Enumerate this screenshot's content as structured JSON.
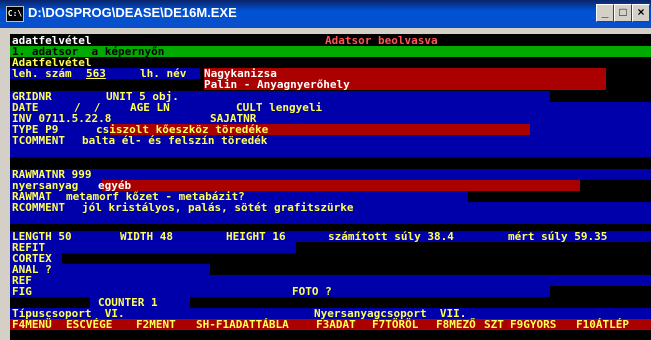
{
  "window": {
    "title": "D:\\DOSPROG\\DEASE\\DE16M.EXE",
    "icon_label": "C:\\",
    "minimize": "_",
    "maximize": "□",
    "close": "×"
  },
  "screen": {
    "header_left": "adatfelvétel",
    "header_right": "Adatsor beolvasva",
    "menu_line": "1. adatsor  a képernyőn",
    "section_title": "Adatfelvétel",
    "leh_label": "leh. szám",
    "leh_value": "563",
    "lh_label": "lh. név",
    "lh_value1": "Nagykanizsa",
    "lh_value2": "Palin - Anyagnyerőhely",
    "gridnr_label": "GRIDNR",
    "unit_label": "UNIT 5 obj.",
    "date_label": "DATE",
    "date_value": "/  /",
    "age_label": "AGE LN",
    "cult_label": "CULT lengyeli",
    "inv_label": "INV 0711.5.22.8",
    "sajatnr_label": "SAJATNR",
    "type_label": "TYPE P9",
    "type_value": "csiszolt kőeszköz töredéke",
    "tcomment_label": "TCOMMENT",
    "tcomment_value": "balta él- és felszín töredék",
    "rawmatnr_label": "RAWMATNR 999",
    "nyersanyag_label": "nyersanyag",
    "nyersanyag_value": "egyéb",
    "rawmat_label": "RAWMAT",
    "rawmat_value": "metamorf kőzet - metabázit?",
    "rcomment_label": "RCOMMENT",
    "rcomment_value": "jól kristályos, palás, sötét grafitszürke",
    "length": "LENGTH 50",
    "width": "WIDTH 48",
    "height": "HEIGHT 16",
    "computed_weight": "számított súly 38.4",
    "measured_weight": "mért súly 59.35",
    "refit": "REFIT",
    "cortex": "CORTEX",
    "anal": "ANAL ?",
    "ref": "REF",
    "fig": "FIG",
    "foto": "FOTO ?",
    "counter": "COUNTER 1",
    "tipuscsoport": "Típuscsoport  VI.",
    "nyersanyagcsoport": "Nyersanyagcsoport  VII."
  },
  "fkeys": [
    {
      "key": "F4",
      "label": "MENÜ"
    },
    {
      "key": "ESC",
      "label": "VÉGE"
    },
    {
      "key": "F2",
      "label": "MENT"
    },
    {
      "key": "SH-F1",
      "label": "ADATTÁBLA"
    },
    {
      "key": "F3",
      "label": "ADAT"
    },
    {
      "key": "F7",
      "label": "TÖRÖL"
    },
    {
      "key": "F8",
      "label": "MEZŐ"
    },
    {
      "key": "",
      "label": "SZT"
    },
    {
      "key": "F9",
      "label": "GYORS"
    },
    {
      "key": "F10",
      "label": "ÁTLÉP"
    }
  ],
  "colors": {
    "console_bg": "#000000",
    "field_blue": "#0000aa",
    "field_red": "#aa0000",
    "menu_green": "#00aa00",
    "text_yellow": "#ffff55",
    "text_red": "#ff5555"
  }
}
